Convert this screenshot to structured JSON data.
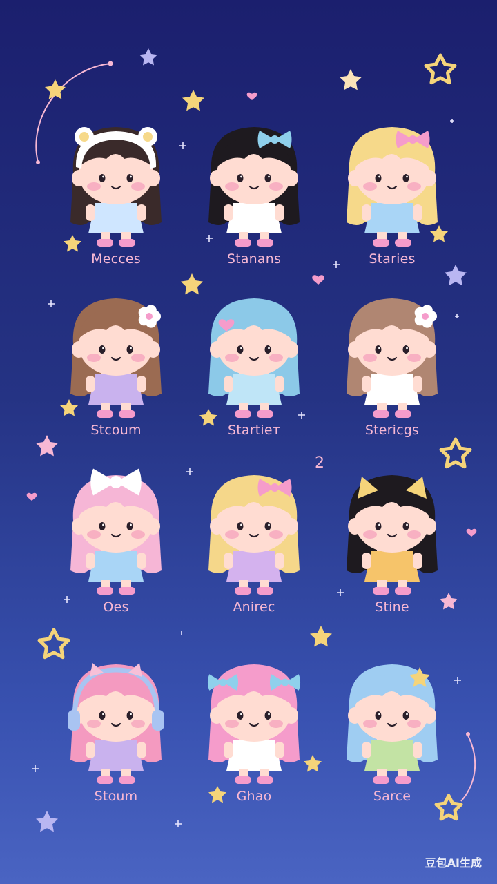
{
  "characters": [
    {
      "name": "Mecces",
      "hair": "#3a2a2a",
      "dress": "#cfe6ff",
      "accessory": "cat-ear-hood",
      "accColor": "#ffffff"
    },
    {
      "name": "Stanans",
      "hair": "#1e1a1f",
      "dress": "#ffffff",
      "accessory": "bow",
      "accColor": "#8fd0ec"
    },
    {
      "name": "Staries",
      "hair": "#f6d98a",
      "dress": "#a9d5f6",
      "accessory": "bow",
      "accColor": "#f59ccb"
    },
    {
      "name": "Stcoum",
      "hair": "#9b6b52",
      "dress": "#c9b2ee",
      "accessory": "flower",
      "accColor": "#ffffff"
    },
    {
      "name": "Startieт",
      "hair": "#8cc9e8",
      "dress": "#bfe5f7",
      "accessory": "heart",
      "accColor": "#f59ccb"
    },
    {
      "name": "Stericgs",
      "hair": "#b08672",
      "dress": "#ffffff",
      "accessory": "flower",
      "accColor": "#ffffff"
    },
    {
      "name": "Oes",
      "hair": "#f6b6d6",
      "dress": "#a9d5f6",
      "accessory": "big-bow",
      "accColor": "#ffffff"
    },
    {
      "name": "Anirec",
      "hair": "#f5d78a",
      "dress": "#d4b2ee",
      "accessory": "bow",
      "accColor": "#f59ccb"
    },
    {
      "name": "Stine",
      "hair": "#1e1a1f",
      "dress": "#f6c46a",
      "accessory": "cat-ears",
      "accColor": "#f5d47a"
    },
    {
      "name": "Stoum",
      "hair": "#f49ac0",
      "dress": "#c9b2ee",
      "accessory": "headphones",
      "accColor": "#a9c4f2"
    },
    {
      "name": "Ghao",
      "hair": "#f59ccb",
      "dress": "#ffffff",
      "accessory": "twin-bows",
      "accColor": "#8fd0ec"
    },
    {
      "name": "Sarce",
      "hair": "#9fcdf2",
      "dress": "#c3e3a4",
      "accessory": "star",
      "accColor": "#f5d47a"
    }
  ],
  "stray_mark": "2",
  "watermark": "豆包AI生成",
  "colors": {
    "star": "#f5d47a",
    "pink": "#f7b8d4",
    "lavender": "#b9b6f2"
  }
}
